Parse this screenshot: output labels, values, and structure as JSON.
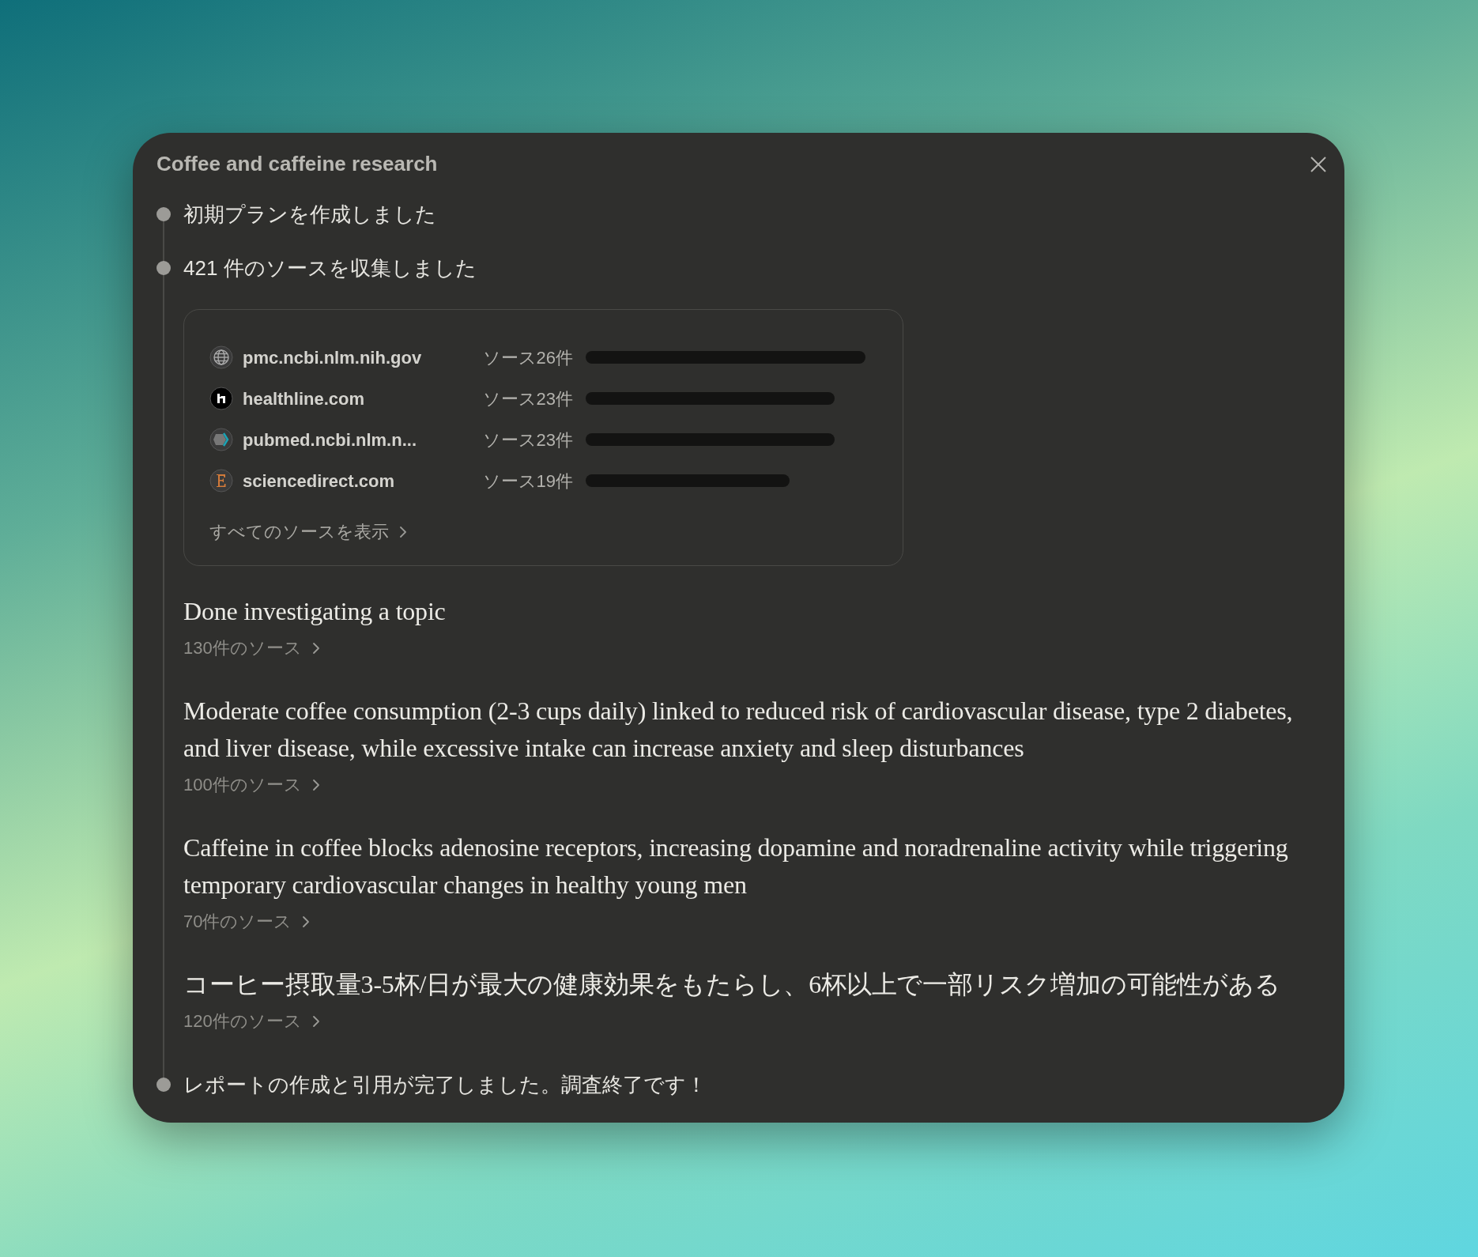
{
  "panel": {
    "title": "Coffee and caffeine research"
  },
  "steps": [
    {
      "kind": "text",
      "label": "初期プランを作成しました"
    },
    {
      "kind": "sources",
      "label": "421 件のソースを収集しました",
      "sources": [
        {
          "domain": "pmc.ncbi.nlm.nih.gov",
          "count": "ソース26件",
          "kind": "globe"
        },
        {
          "domain": "healthline.com",
          "count": "ソース23件",
          "kind": "house"
        },
        {
          "domain": "pubmed.ncbi.nlm.n...",
          "count": "ソース23件",
          "kind": "hexagon"
        },
        {
          "domain": "sciencedirect.com",
          "count": "ソース19件",
          "kind": "letter"
        }
      ],
      "show_all": "すべてのソースを表示",
      "findings": [
        {
          "title": "Done investigating a topic",
          "sources": "130件のソース"
        },
        {
          "title": "Moderate coffee consumption (2-3 cups daily) linked to reduced risk of cardiovascular disease, type 2 diabetes, and liver disease, while excessive intake can increase anxiety and sleep disturbances",
          "sources": "100件のソース"
        },
        {
          "title": "Caffeine in coffee blocks adenosine receptors, increasing dopamine and noradrenaline activity while triggering temporary cardiovascular changes in healthy young men",
          "sources": "70件のソース"
        },
        {
          "title": "コーヒー摂取量3-5杯/日が最大の健康効果をもたらし、6杯以上で一部リスク増加の可能性がある",
          "sources": "120件のソース"
        }
      ]
    },
    {
      "kind": "text",
      "label": "レポートの作成と引用が完了しました。調査終了です！"
    }
  ]
}
